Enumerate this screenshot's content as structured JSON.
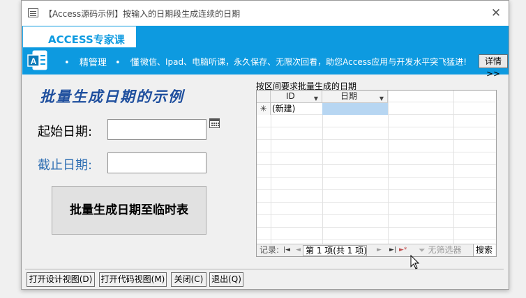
{
  "window": {
    "title": "【Access源码示例】按输入的日期段生成连续的日期",
    "close_symbol": "✕"
  },
  "banner": {
    "brand": "ACCESS专家课",
    "nav": [
      "精管理",
      "懂"
    ],
    "marquee": "微信、Ipad、电脑听课，永久保存、无限次回看，助您Access应用与开发水平突飞猛进!",
    "detail_button": "详情>>",
    "bg_color": "#0d9ae0"
  },
  "form": {
    "heading": "批量生成日期的示例",
    "start_label": "起始日期:",
    "start_value": "",
    "end_label": "截止日期:",
    "end_value": "",
    "generate_button": "批量生成日期至临时表"
  },
  "subform": {
    "title": "按区间要求批量生成的日期",
    "columns": [
      "ID",
      "日期"
    ],
    "new_row": {
      "selector": "✳",
      "id": "(新建)",
      "date": ""
    },
    "navbar": {
      "label": "记录:",
      "first": "◄",
      "prev": "◄",
      "position": "第 1 项(共 1 项)",
      "next": "►",
      "last": "►",
      "new": "►*",
      "filter": "无筛选器",
      "search": "搜索"
    }
  },
  "footer": {
    "design_view": "打开设计视图(D)",
    "code_view": "打开代码视图(M)",
    "close": "关闭(C)",
    "exit": "退出(Q)"
  }
}
